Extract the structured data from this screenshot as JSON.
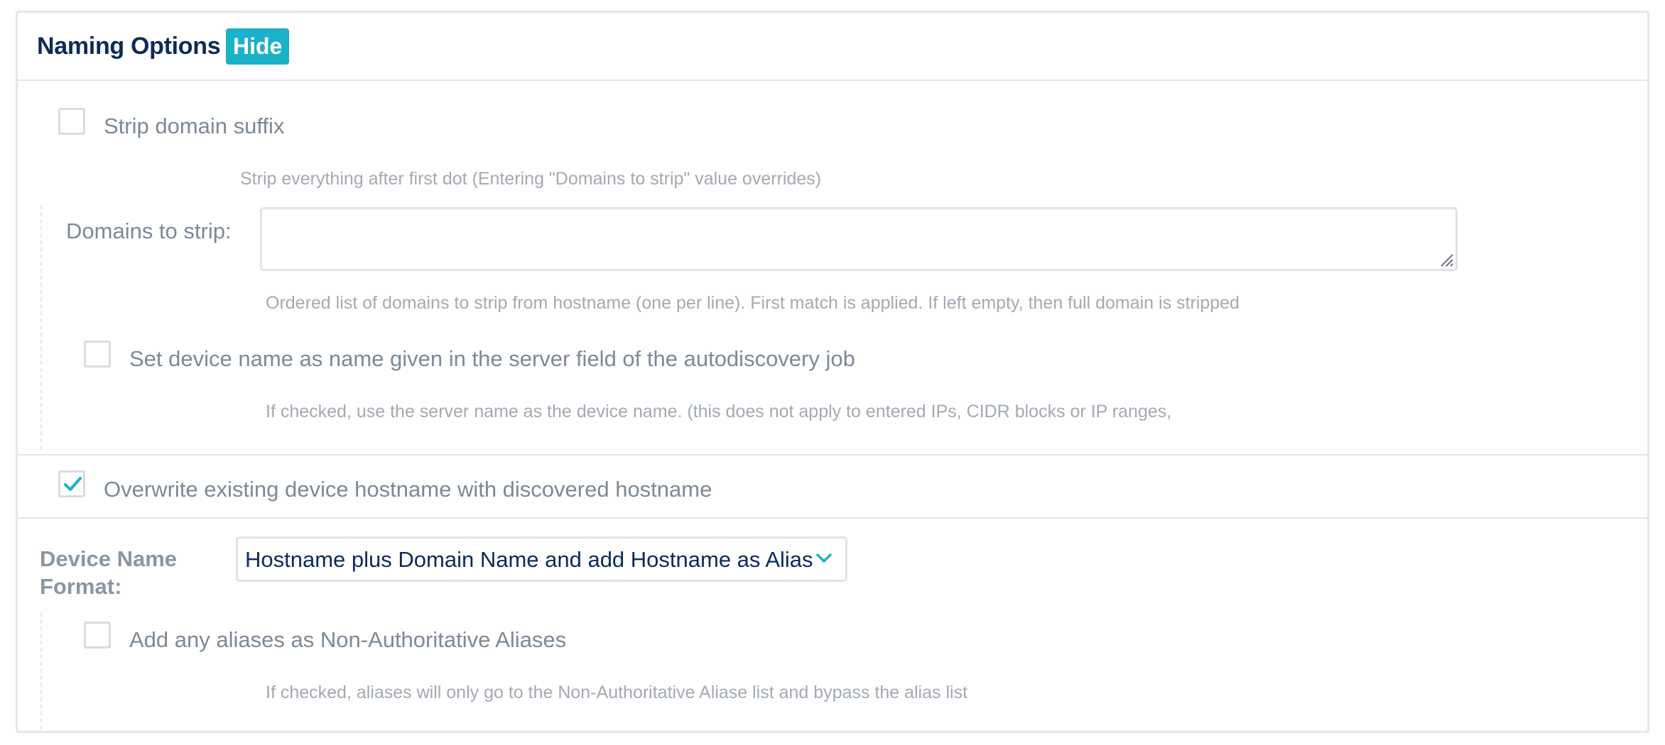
{
  "panel": {
    "title": "Naming Options",
    "hide_label": "Hide"
  },
  "strip_domain": {
    "checked": false,
    "label": "Strip domain suffix",
    "help": "Strip everything after first dot (Entering \"Domains to strip\" value overrides)"
  },
  "domains_to_strip": {
    "label": "Domains to strip:",
    "value": "",
    "help": "Ordered list of domains to strip from hostname (one per line). First match is applied. If left empty, then full domain is stripped"
  },
  "server_name": {
    "checked": false,
    "label": "Set device name as name given in the server field of the autodiscovery job",
    "help": "If checked, use the server name as the device name. (this does not apply to entered IPs, CIDR blocks or IP ranges,"
  },
  "overwrite_hostname": {
    "checked": true,
    "label": "Overwrite existing device hostname with discovered hostname"
  },
  "device_name_format": {
    "label_line1": "Device Name",
    "label_line2": "Format:",
    "selected": "Hostname plus Domain Name and add Hostname as Alias"
  },
  "non_auth_aliases": {
    "checked": false,
    "label": "Add any aliases as Non-Authoritative Aliases",
    "help": "If checked, aliases will only go to the Non-Authoritative Aliase list and bypass the alias list"
  },
  "colors": {
    "accent": "#1ab2c8",
    "title": "#0c2a5b",
    "border": "#e3e6ea",
    "muted_text": "#a3aab2"
  }
}
